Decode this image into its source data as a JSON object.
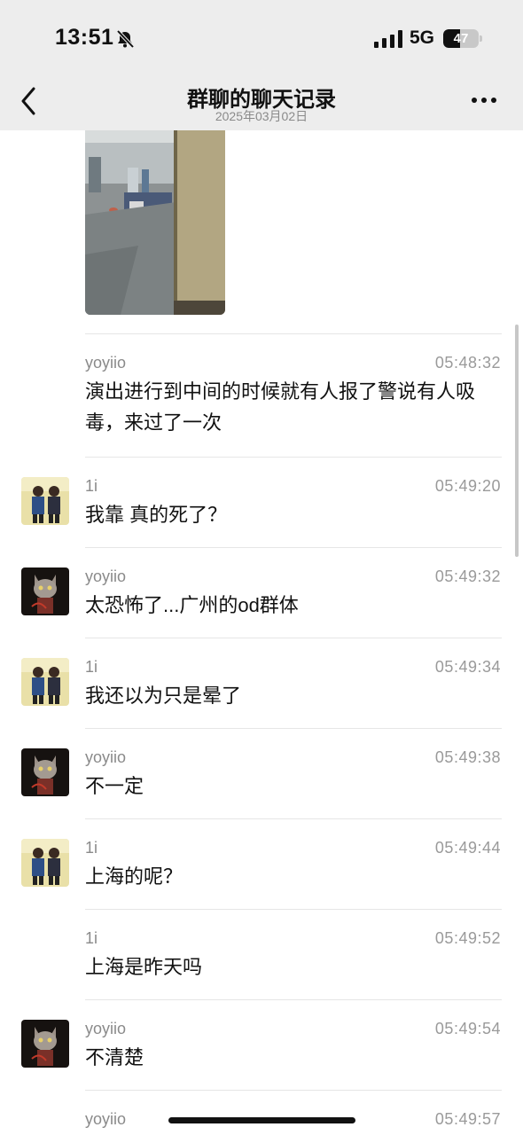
{
  "status_bar": {
    "time": "13:51",
    "network": "5G",
    "battery": "47",
    "battery_level": 0.47
  },
  "header": {
    "title": "群聊的聊天记录",
    "subtitle": "2025年03月02日"
  },
  "messages": [
    {
      "sender": "yoyiio",
      "time": "05:48:32",
      "text": "演出进行到中间的时候就有人报了警说有人吸毒，来过了一次",
      "avatar": "none"
    },
    {
      "sender": "1i",
      "time": "05:49:20",
      "text": "我靠 真的死了？",
      "avatar": "two-people-photo"
    },
    {
      "sender": "yoyiio",
      "time": "05:49:32",
      "text": "太恐怖了...广州的od群体",
      "avatar": "cat-photo"
    },
    {
      "sender": "1i",
      "time": "05:49:34",
      "text": "我还以为只是晕了",
      "avatar": "two-people-photo"
    },
    {
      "sender": "yoyiio",
      "time": "05:49:38",
      "text": "不一定",
      "avatar": "cat-photo"
    },
    {
      "sender": "1i",
      "time": "05:49:44",
      "text": "上海的呢？",
      "avatar": "two-people-photo"
    },
    {
      "sender": "1i",
      "time": "05:49:52",
      "text": "上海是昨天吗",
      "avatar": "none"
    },
    {
      "sender": "yoyiio",
      "time": "05:49:54",
      "text": "不清楚",
      "avatar": "cat-photo"
    },
    {
      "sender": "yoyiio",
      "time": "05:49:57",
      "text": "",
      "avatar": "none"
    }
  ]
}
